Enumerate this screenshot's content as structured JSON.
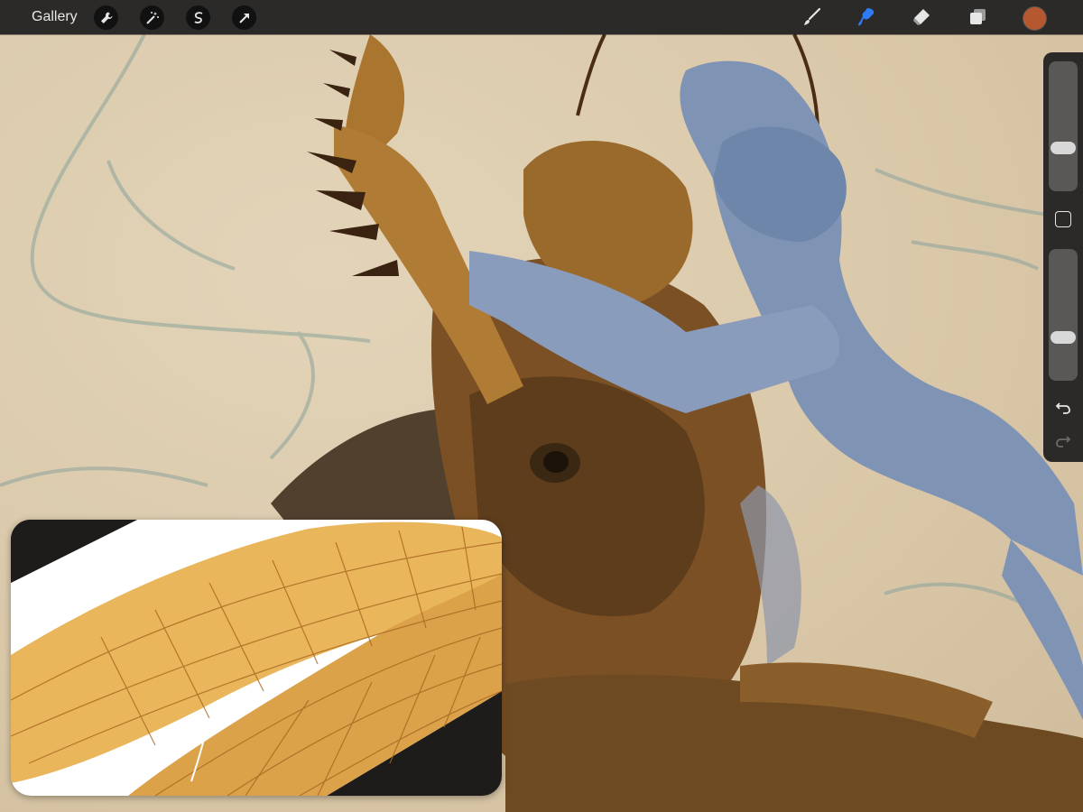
{
  "app": {
    "gallery_label": "Gallery"
  },
  "toolbar": {
    "actions": [
      {
        "icon": "wrench-icon"
      },
      {
        "icon": "magic-wand-icon"
      },
      {
        "icon": "selection-s-icon"
      },
      {
        "icon": "transform-arrow-icon"
      }
    ],
    "tools": [
      {
        "icon": "brush-icon",
        "active": false
      },
      {
        "icon": "smudge-icon",
        "active": true
      },
      {
        "icon": "eraser-icon",
        "active": false
      },
      {
        "icon": "layers-icon",
        "active": false
      }
    ],
    "current_color": "#b5582f",
    "active_tool_color": "#2f7bf6"
  },
  "sidebar": {
    "brush_size_level": 0.3,
    "opacity_level": 0.3
  }
}
